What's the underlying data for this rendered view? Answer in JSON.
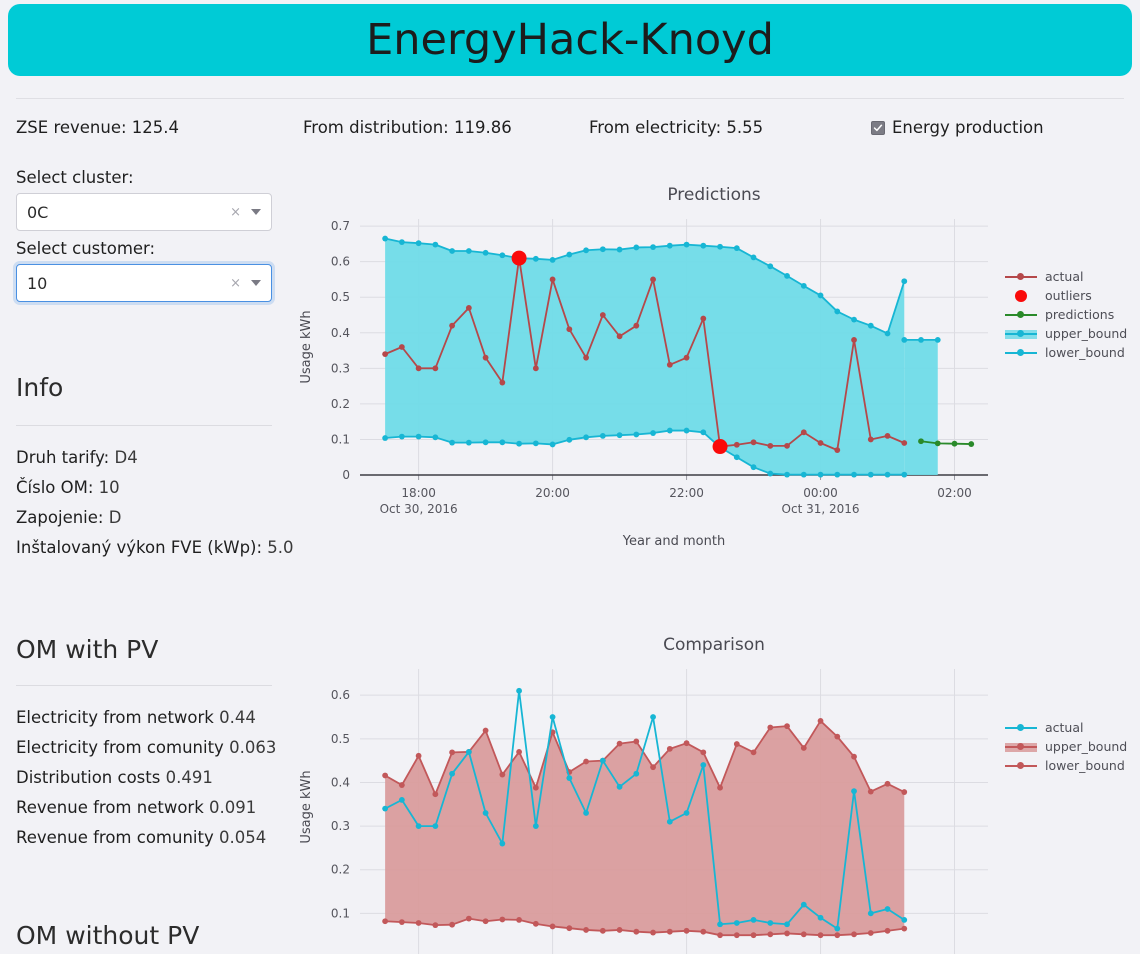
{
  "app": {
    "title": "EnergyHack-Knoyd",
    "banner_color": "#00cbd6",
    "background": "#f2f2f6"
  },
  "metrics": [
    {
      "label": "ZSE revenue:",
      "value": "125.4",
      "text": "ZSE revenue: 125.4"
    },
    {
      "label": "From distribution:",
      "value": "119.86",
      "text": "From distribution: 119.86"
    },
    {
      "label": "From electricity:",
      "value": "5.55",
      "text": "From electricity: 5.55"
    }
  ],
  "toggle": {
    "label": "Energy production",
    "checked": true,
    "icon": "checkmark-icon"
  },
  "sidebar": {
    "cluster": {
      "label": "Select cluster:",
      "value": "0C",
      "clear_icon": "clear-x-icon",
      "caret_icon": "chevron-down-icon",
      "focused": false
    },
    "customer": {
      "label": "Select customer:",
      "value": "10",
      "clear_icon": "clear-x-icon",
      "caret_icon": "chevron-down-icon",
      "focused": true
    },
    "info": {
      "title": "Info",
      "rows": [
        {
          "label": "Druh tarify:",
          "value": "D4"
        },
        {
          "label": "Číslo OM:",
          "value": "10"
        },
        {
          "label": "Zapojenie:",
          "value": "D"
        },
        {
          "label": "Inštalovaný výkon FVE (kWp):",
          "value": "5.0"
        }
      ]
    },
    "om_with_pv": {
      "title": "OM with PV",
      "rows": [
        {
          "label": "Electricity from network",
          "value": "0.44"
        },
        {
          "label": "Electricity from comunity",
          "value": "0.063"
        },
        {
          "label": "Distribution costs",
          "value": "0.491"
        },
        {
          "label": "Revenue from network",
          "value": "0.091"
        },
        {
          "label": "Revenue from comunity",
          "value": "0.054"
        }
      ]
    },
    "om_without_pv": {
      "title": "OM without PV"
    }
  },
  "chart_data": [
    {
      "id": "predictions",
      "type": "line",
      "title": "Predictions",
      "xlabel": "Year and month",
      "ylabel": "Usage kWh",
      "ylim": [
        0,
        0.72
      ],
      "yticks": [
        0,
        0.1,
        0.2,
        0.3,
        0.4,
        0.5,
        0.6,
        0.7
      ],
      "ytick_labels": [
        "0",
        "0.1",
        "0.2",
        "0.3",
        "0.4",
        "0.5",
        "0.6",
        "0.7"
      ],
      "xticks": [
        2,
        10,
        18,
        26,
        34
      ],
      "xtick_labels": [
        "18:00",
        "20:00",
        "22:00",
        "00:00",
        "02:00"
      ],
      "xtick_sublabels": [
        "Oct 30, 2016",
        "",
        "",
        "Oct 31, 2016",
        ""
      ],
      "grid": true,
      "legend_position": "right",
      "xlim": [
        -1.5,
        36
      ],
      "colors": {
        "actual": "#b5484a",
        "outliers": "#fa0a0a",
        "predictions": "#2a8a2a",
        "upper_bound": "#4ad4e0",
        "lower_bound": "#17b6d4",
        "band_fill": "#6fdbe8"
      },
      "series": [
        {
          "name": "actual",
          "color": "#b5484a",
          "x": [
            0,
            1,
            2,
            3,
            4,
            5,
            6,
            7,
            8,
            9,
            10,
            11,
            12,
            13,
            14,
            15,
            16,
            17,
            18,
            19,
            20,
            21,
            22,
            23,
            24,
            25,
            26,
            27,
            28,
            29,
            30,
            31
          ],
          "values": [
            0.34,
            0.36,
            0.3,
            0.3,
            0.42,
            0.47,
            0.33,
            0.26,
            0.61,
            0.3,
            0.55,
            0.41,
            0.33,
            0.45,
            0.39,
            0.42,
            0.55,
            0.31,
            0.33,
            0.44,
            0.08,
            0.085,
            0.092,
            0.082,
            0.082,
            0.12,
            0.09,
            0.07,
            0.38,
            0.1,
            0.11,
            0.09
          ]
        },
        {
          "name": "outliers",
          "color": "#fa0a0a",
          "x": [
            8,
            20
          ],
          "values": [
            0.61,
            0.08
          ]
        },
        {
          "name": "predictions",
          "color": "#2a8a2a",
          "x": [
            32,
            33,
            34,
            35
          ],
          "values": [
            0.095,
            0.089,
            0.088,
            0.087
          ]
        },
        {
          "name": "upper_bound",
          "color": "#17b6d4",
          "x": [
            0,
            1,
            2,
            3,
            4,
            5,
            6,
            7,
            8,
            9,
            10,
            11,
            12,
            13,
            14,
            15,
            16,
            17,
            18,
            19,
            20,
            21,
            22,
            23,
            24,
            25,
            26,
            27,
            28,
            29,
            30,
            31
          ],
          "values": [
            0.665,
            0.655,
            0.652,
            0.648,
            0.63,
            0.63,
            0.625,
            0.618,
            0.61,
            0.608,
            0.605,
            0.62,
            0.632,
            0.635,
            0.634,
            0.64,
            0.641,
            0.645,
            0.648,
            0.645,
            0.642,
            0.638,
            0.612,
            0.587,
            0.56,
            0.532,
            0.505,
            0.46,
            0.437,
            0.42,
            0.398,
            0.545
          ]
        },
        {
          "name": "upper_bound_tail",
          "color": "#17b6d4",
          "x": [
            31,
            32,
            33
          ],
          "values": [
            0.38,
            0.38,
            0.38
          ]
        },
        {
          "name": "lower_bound",
          "color": "#17b6d4",
          "x": [
            0,
            1,
            2,
            3,
            4,
            5,
            6,
            7,
            8,
            9,
            10,
            11,
            12,
            13,
            14,
            15,
            16,
            17,
            18,
            19,
            20,
            21,
            22,
            23,
            24,
            25,
            26,
            27,
            28,
            29,
            30,
            31
          ],
          "values": [
            0.104,
            0.108,
            0.108,
            0.106,
            0.091,
            0.091,
            0.092,
            0.092,
            0.088,
            0.089,
            0.086,
            0.099,
            0.106,
            0.11,
            0.112,
            0.114,
            0.118,
            0.125,
            0.125,
            0.12,
            0.078,
            0.05,
            0.022,
            0.004,
            0.001,
            0.001,
            0.001,
            0.001,
            0.001,
            0.001,
            0.001,
            0.001
          ]
        }
      ]
    },
    {
      "id": "comparison",
      "type": "line",
      "title": "Comparison",
      "xlabel": "",
      "ylabel": "Usage kWh",
      "ylim": [
        0,
        0.66
      ],
      "yticks": [
        0.1,
        0.2,
        0.3,
        0.4,
        0.5,
        0.6
      ],
      "ytick_labels": [
        "0.1",
        "0.2",
        "0.3",
        "0.4",
        "0.5",
        "0.6"
      ],
      "grid": true,
      "legend_position": "right",
      "xlim": [
        -1.5,
        36
      ],
      "colors": {
        "actual": "#17b6d4",
        "upper_bound": "#c2585a",
        "lower_bound": "#c2585a",
        "band_fill": "#d99a9a"
      },
      "series": [
        {
          "name": "actual",
          "color": "#17b6d4",
          "x": [
            0,
            1,
            2,
            3,
            4,
            5,
            6,
            7,
            8,
            9,
            10,
            11,
            12,
            13,
            14,
            15,
            16,
            17,
            18,
            19,
            20,
            21,
            22,
            23,
            24,
            25,
            26,
            27,
            28,
            29,
            30,
            31
          ],
          "values": [
            0.34,
            0.36,
            0.3,
            0.3,
            0.42,
            0.47,
            0.33,
            0.26,
            0.61,
            0.3,
            0.55,
            0.41,
            0.33,
            0.45,
            0.39,
            0.42,
            0.55,
            0.31,
            0.33,
            0.44,
            0.075,
            0.078,
            0.085,
            0.078,
            0.075,
            0.12,
            0.09,
            0.065,
            0.38,
            0.1,
            0.11,
            0.085
          ]
        },
        {
          "name": "upper_bound",
          "color": "#c2585a",
          "x": [
            0,
            1,
            2,
            3,
            4,
            5,
            6,
            7,
            8,
            9,
            10,
            11,
            12,
            13,
            14,
            15,
            16,
            17,
            18,
            19,
            20,
            21,
            22,
            23,
            24,
            25,
            26,
            27,
            28,
            29,
            30,
            31
          ],
          "values": [
            0.416,
            0.394,
            0.461,
            0.373,
            0.469,
            0.47,
            0.519,
            0.418,
            0.47,
            0.388,
            0.515,
            0.424,
            0.448,
            0.45,
            0.489,
            0.494,
            0.435,
            0.477,
            0.49,
            0.469,
            0.388,
            0.488,
            0.469,
            0.526,
            0.529,
            0.479,
            0.541,
            0.505,
            0.459,
            0.379,
            0.397,
            0.378
          ]
        },
        {
          "name": "lower_bound",
          "color": "#c2585a",
          "x": [
            0,
            1,
            2,
            3,
            4,
            5,
            6,
            7,
            8,
            9,
            10,
            11,
            12,
            13,
            14,
            15,
            16,
            17,
            18,
            19,
            20,
            21,
            22,
            23,
            24,
            25,
            26,
            27,
            28,
            29,
            30,
            31
          ],
          "values": [
            0.082,
            0.08,
            0.078,
            0.073,
            0.074,
            0.088,
            0.082,
            0.086,
            0.085,
            0.076,
            0.07,
            0.066,
            0.062,
            0.06,
            0.062,
            0.058,
            0.056,
            0.058,
            0.06,
            0.058,
            0.05,
            0.05,
            0.05,
            0.052,
            0.054,
            0.052,
            0.05,
            0.05,
            0.052,
            0.055,
            0.06,
            0.065
          ]
        }
      ]
    }
  ]
}
